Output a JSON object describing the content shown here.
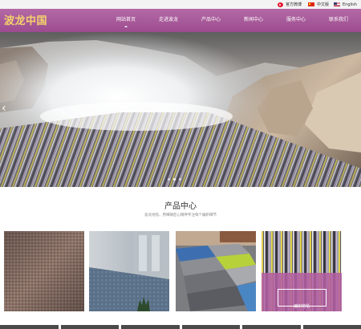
{
  "topbar": {
    "weibo_label": "官方微博",
    "chinese_label": "中文版",
    "english_label": "English",
    "icons": [
      "weibo-icon",
      "flag-cn-icon",
      "flag-us-icon"
    ]
  },
  "header": {
    "logo": "波龙中国",
    "brand_color": "#a85699",
    "logo_color": "#f4d36b",
    "nav": [
      "网站首页",
      "走进波龙",
      "产品中心",
      "新闻中心",
      "服务中心",
      "联系我们"
    ]
  },
  "hero": {
    "prev_icon": "chevron-left-icon",
    "slide_count": 3,
    "active_slide": 1
  },
  "products": {
    "title": "产品中心",
    "subtitle": "波龙地毯，用细微匠心精神专注每个编织细节",
    "cards": [
      {
        "name": "brown-texture"
      },
      {
        "name": "blue-room"
      },
      {
        "name": "tile-floor"
      },
      {
        "name": "stripe-pink",
        "label": "编织地毯"
      }
    ]
  }
}
